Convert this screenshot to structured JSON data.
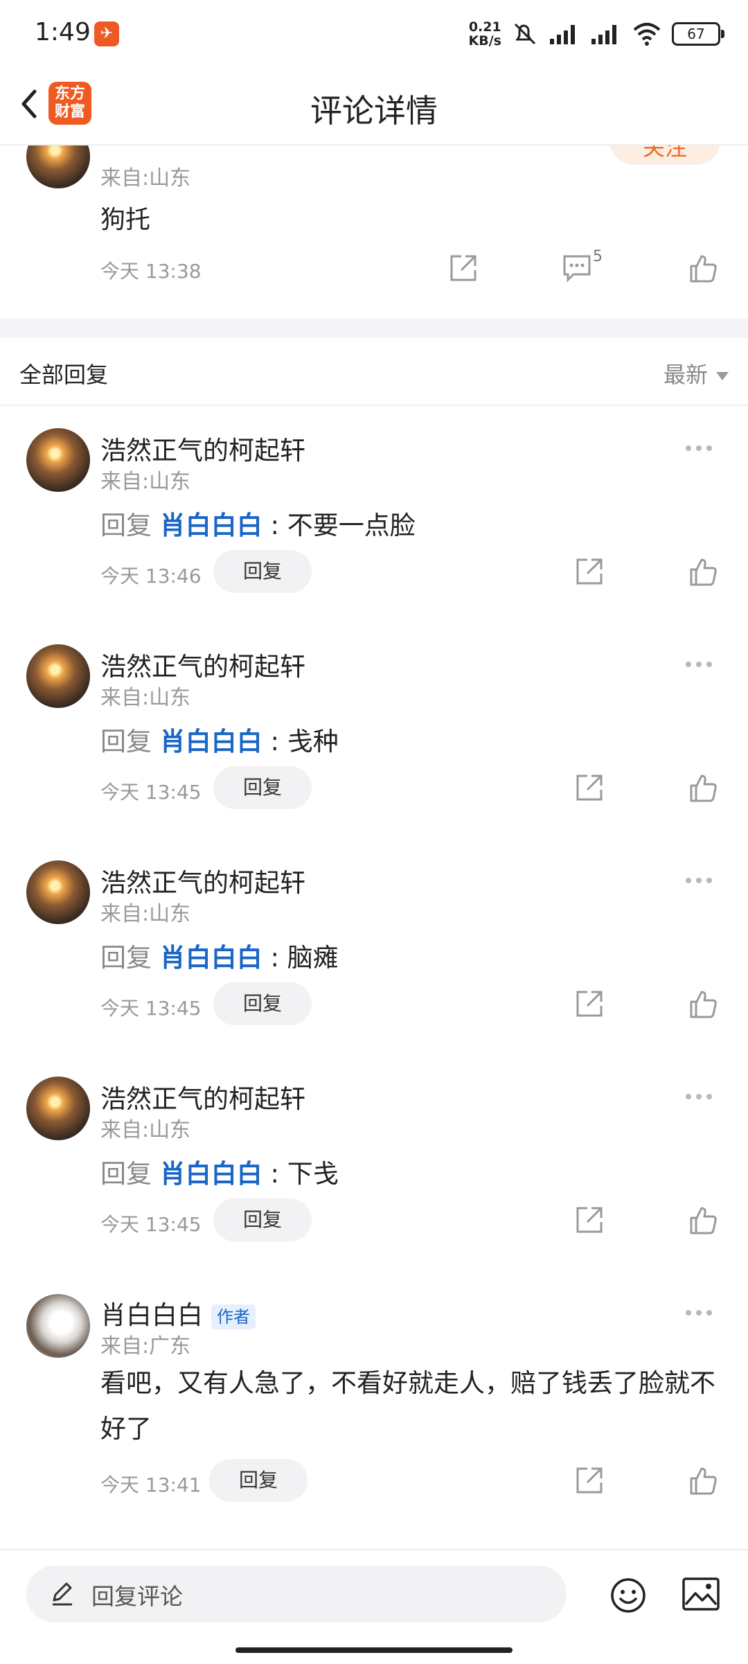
{
  "status_bar": {
    "time": "1:49",
    "speed_top": "0.21",
    "speed_bottom": "KB/s",
    "battery": "67"
  },
  "header": {
    "logo_line1": "东方",
    "logo_line2": "财富",
    "title": "评论详情"
  },
  "top_comment": {
    "follow_label": "关注",
    "location": "来自:山东",
    "content": "狗托",
    "time": "今天 13:38",
    "comment_count": "5"
  },
  "section": {
    "title": "全部回复",
    "sort": "最新"
  },
  "replies": [
    {
      "name": "浩然正气的柯起轩",
      "location": "来自:山东",
      "prefix": "回复",
      "target": "肖白白白",
      "sep": " : ",
      "text": "不要一点脸",
      "time": "今天 13:46",
      "reply_label": "回复"
    },
    {
      "name": "浩然正气的柯起轩",
      "location": "来自:山东",
      "prefix": "回复",
      "target": "肖白白白",
      "sep": " : ",
      "text": "戋种",
      "time": "今天 13:45",
      "reply_label": "回复"
    },
    {
      "name": "浩然正气的柯起轩",
      "location": "来自:山东",
      "prefix": "回复",
      "target": "肖白白白",
      "sep": " : ",
      "text": "脑瘫",
      "time": "今天 13:45",
      "reply_label": "回复"
    },
    {
      "name": "浩然正气的柯起轩",
      "location": "来自:山东",
      "prefix": "回复",
      "target": "肖白白白",
      "sep": " : ",
      "text": "下戋",
      "time": "今天 13:45",
      "reply_label": "回复"
    }
  ],
  "author_reply": {
    "name": "肖白白白",
    "badge": "作者",
    "location": "来自:广东",
    "text": "看吧，又有人急了，不看好就走人，赔了钱丢了脸就不好了",
    "time": "今天 13:41",
    "reply_label": "回复"
  },
  "bottom_bar": {
    "placeholder": "回复评论"
  }
}
